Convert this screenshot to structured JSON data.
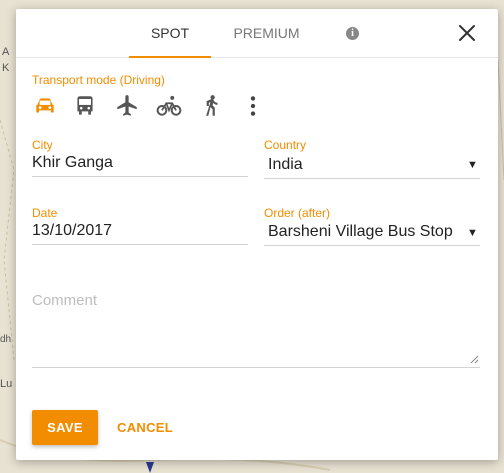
{
  "tabs": [
    {
      "label": "SPOT",
      "active": true
    },
    {
      "label": "PREMIUM",
      "active": false
    }
  ],
  "icons": {
    "info": "info-icon",
    "close": "close-icon",
    "modes": [
      "car-icon",
      "bus-icon",
      "plane-icon",
      "bicycle-icon",
      "walk-icon",
      "more-vert-icon"
    ]
  },
  "transport": {
    "label": "Transport mode (Driving)",
    "selected": "car"
  },
  "city": {
    "label": "City",
    "value": "Khir Ganga"
  },
  "country": {
    "label": "Country",
    "value": "India"
  },
  "date": {
    "label": "Date",
    "value": "13/10/2017"
  },
  "order": {
    "label": "Order (after)",
    "value": "Barsheni Village Bus Stop"
  },
  "comment": {
    "placeholder": "Comment",
    "value": ""
  },
  "actions": {
    "save": "SAVE",
    "cancel": "CANCEL"
  },
  "map_fragments": {
    "left_a": "A",
    "left_k": "K",
    "left_dh": "dh",
    "left_lu": "Lu"
  },
  "colors": {
    "accent": "#f28c00",
    "icon": "#555555"
  }
}
